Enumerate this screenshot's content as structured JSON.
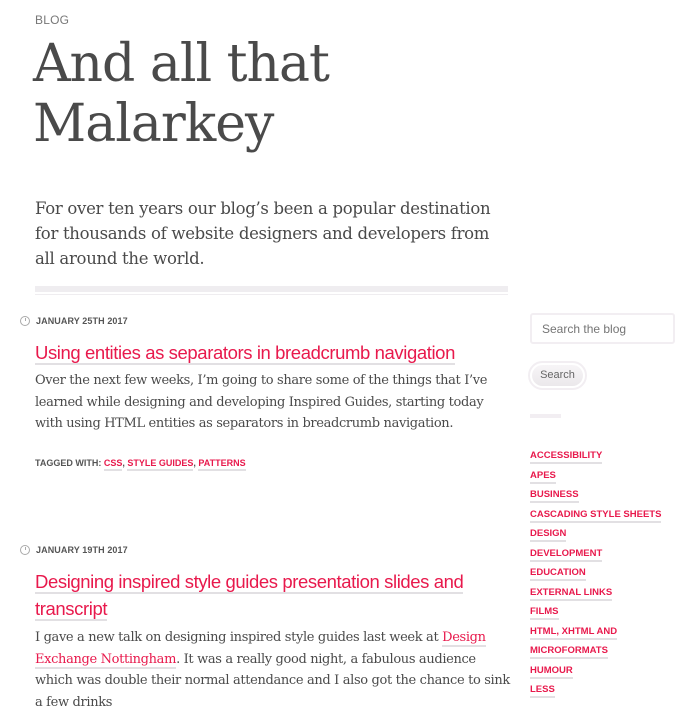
{
  "header": {
    "kicker": "BLOG",
    "title_line1": "And all that",
    "title_line2": "Malarkey",
    "intro": "For over ten years our blog’s been a popular destination for thousands of website designers and developers from all around the world."
  },
  "posts": [
    {
      "date": "JANUARY 25TH 2017",
      "title": "Using entities as separators in breadcrumb navigation",
      "excerpt": "Over the next few weeks, I’m going to share some of the things that I’ve learned while designing and developing Inspired Guides, starting today with using HTML entities as separators in breadcrumb navigation.",
      "tags_label": "TAGGED WITH:",
      "tags": [
        "CSS",
        "STYLE GUIDES",
        "PATTERNS"
      ]
    },
    {
      "date": "JANUARY 19TH 2017",
      "title_line1": "Designing inspired style guides presentation slides and",
      "title_line2": "transcript",
      "excerpt_before": "I gave a new talk on designing inspired style guides last week at ",
      "excerpt_link": "Design Exchange Nottingham",
      "excerpt_after": ". It was a really good night, a fabulous audience which was double their normal attendance and I also got the chance to sink a few drinks"
    }
  ],
  "sidebar": {
    "search_placeholder": "Search the blog",
    "search_button": "Search",
    "categories": [
      "ACCESSIBILITY",
      "APES",
      "BUSINESS",
      "CASCADING STYLE SHEETS",
      "DESIGN",
      "DEVELOPMENT",
      "EDUCATION",
      "EXTERNAL LINKS",
      "FILMS",
      "HTML, XHTML AND MICROFORMATS",
      "HUMOUR",
      "LESS"
    ]
  },
  "colors": {
    "accent": "#e8194c",
    "text": "#4a4a4a",
    "rule": "#efedf0"
  }
}
